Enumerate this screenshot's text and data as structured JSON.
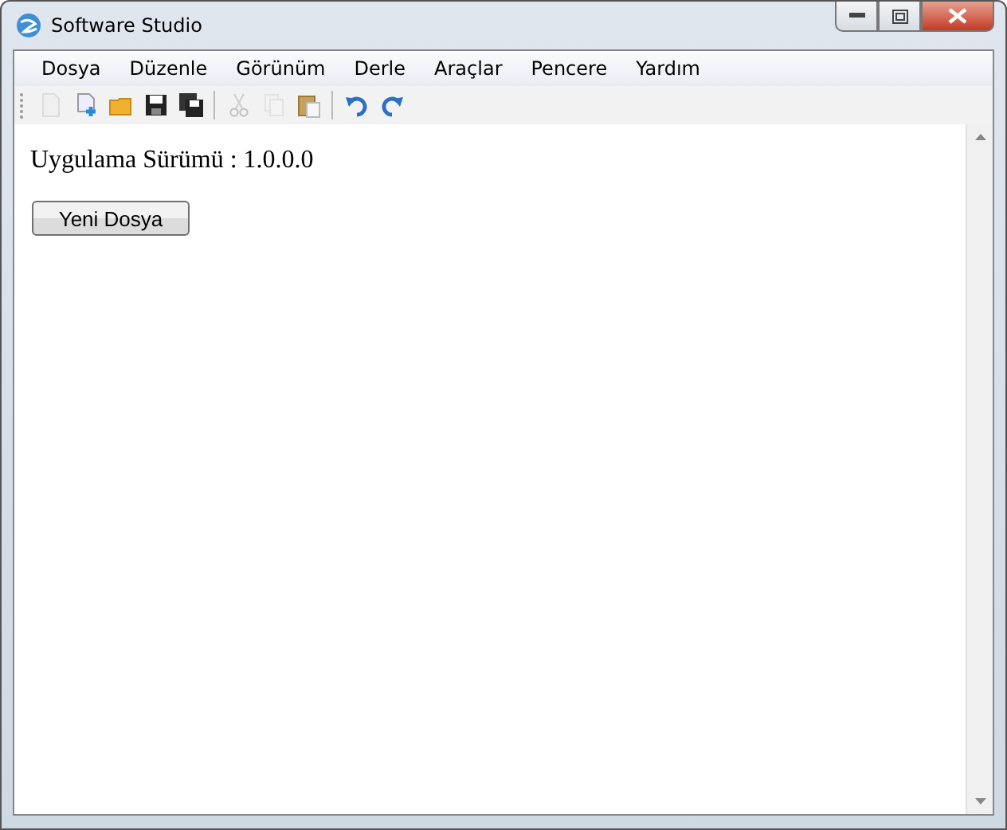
{
  "window": {
    "title": "Software Studio"
  },
  "menu": [
    {
      "label": "Dosya"
    },
    {
      "label": "Düzenle"
    },
    {
      "label": "Görünüm"
    },
    {
      "label": "Derle"
    },
    {
      "label": "Araçlar"
    },
    {
      "label": "Pencere"
    },
    {
      "label": "Yardım"
    }
  ],
  "toolbar": [
    {
      "kind": "new",
      "disabled": true
    },
    {
      "kind": "add",
      "disabled": false
    },
    {
      "kind": "open",
      "disabled": false
    },
    {
      "kind": "save",
      "disabled": false
    },
    {
      "kind": "saveall",
      "disabled": false
    },
    {
      "kind": "sep"
    },
    {
      "kind": "cut",
      "disabled": true
    },
    {
      "kind": "copy",
      "disabled": true
    },
    {
      "kind": "paste",
      "disabled": false
    },
    {
      "kind": "sep"
    },
    {
      "kind": "undo",
      "disabled": false
    },
    {
      "kind": "redo",
      "disabled": false
    }
  ],
  "content": {
    "version_text": "Uygulama Sürümü : 1.0.0.0",
    "button": "Yeni Dosya"
  }
}
